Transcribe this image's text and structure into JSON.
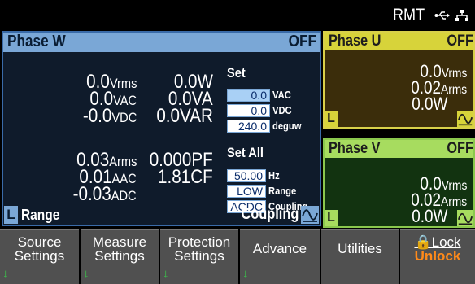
{
  "topbar": {
    "remote": "RMT",
    "usb_icon": "usb-icon",
    "network_icon": "network-icon"
  },
  "phase_w": {
    "title": "Phase W",
    "state": "OFF",
    "voltage": [
      {
        "value": "0.0",
        "unit": "Vrms"
      },
      {
        "value": "0.0",
        "unit": "VAC"
      },
      {
        "value": "-0.0",
        "unit": "VDC"
      }
    ],
    "power": [
      {
        "value": "0.0",
        "unit": "W"
      },
      {
        "value": "0.0",
        "unit": "VA"
      },
      {
        "value": "0.0",
        "unit": "VAR"
      }
    ],
    "current": [
      {
        "value": "0.03",
        "unit": "Arms"
      },
      {
        "value": "0.01",
        "unit": "AAC"
      },
      {
        "value": "-0.03",
        "unit": "ADC"
      }
    ],
    "factors": [
      {
        "value": "0.000",
        "unit": "PF"
      },
      {
        "value": "1.81",
        "unit": "CF"
      }
    ],
    "set": {
      "label": "Set",
      "rows": [
        {
          "value": "0.0",
          "unit": "VAC"
        },
        {
          "value": "0.0",
          "unit": "VDC"
        },
        {
          "value": "240.0",
          "unit": "deguw"
        }
      ]
    },
    "set_all": {
      "label": "Set All",
      "rows": [
        {
          "value": "50.00",
          "unit": "Hz"
        },
        {
          "value": "LOW",
          "unit": "Range"
        },
        {
          "value": "ACDC",
          "unit": "Coupling"
        }
      ]
    },
    "bottom": {
      "badge": "L",
      "range": "Range",
      "coupling": "Coupling",
      "coupling_icon": "ac-wave-icon"
    }
  },
  "phase_u": {
    "title": "Phase U",
    "state": "OFF",
    "values": [
      {
        "value": "0.0",
        "unit": "Vrms"
      },
      {
        "value": "0.02",
        "unit": "Arms"
      },
      {
        "value": "0.0",
        "unit": "W"
      }
    ],
    "badge": "L"
  },
  "phase_v": {
    "title": "Phase V",
    "state": "OFF",
    "values": [
      {
        "value": "0.0",
        "unit": "Vrms"
      },
      {
        "value": "0.02",
        "unit": "Arms"
      },
      {
        "value": "0.0",
        "unit": "W"
      }
    ],
    "badge": "L"
  },
  "softkeys": [
    {
      "line1": "Source",
      "line2": "Settings",
      "arrow": "↓"
    },
    {
      "line1": "Measure",
      "line2": "Settings",
      "arrow": "↓"
    },
    {
      "line1": "Protection",
      "line2": "Settings",
      "arrow": "↓"
    },
    {
      "line1": "Advance",
      "line2": "",
      "arrow": "↓"
    },
    {
      "line1": "Utilities",
      "line2": "",
      "arrow": ""
    },
    {
      "line1": "🔒Lock",
      "line2": "Unlock",
      "arrow": ""
    }
  ],
  "colors": {
    "phase_w_accent": "#7aa7d6",
    "phase_u_accent": "#d7d33a",
    "phase_v_accent": "#a7dc5f",
    "unlock": "#ff8a1a",
    "softkey_arrow": "#38d44a"
  }
}
